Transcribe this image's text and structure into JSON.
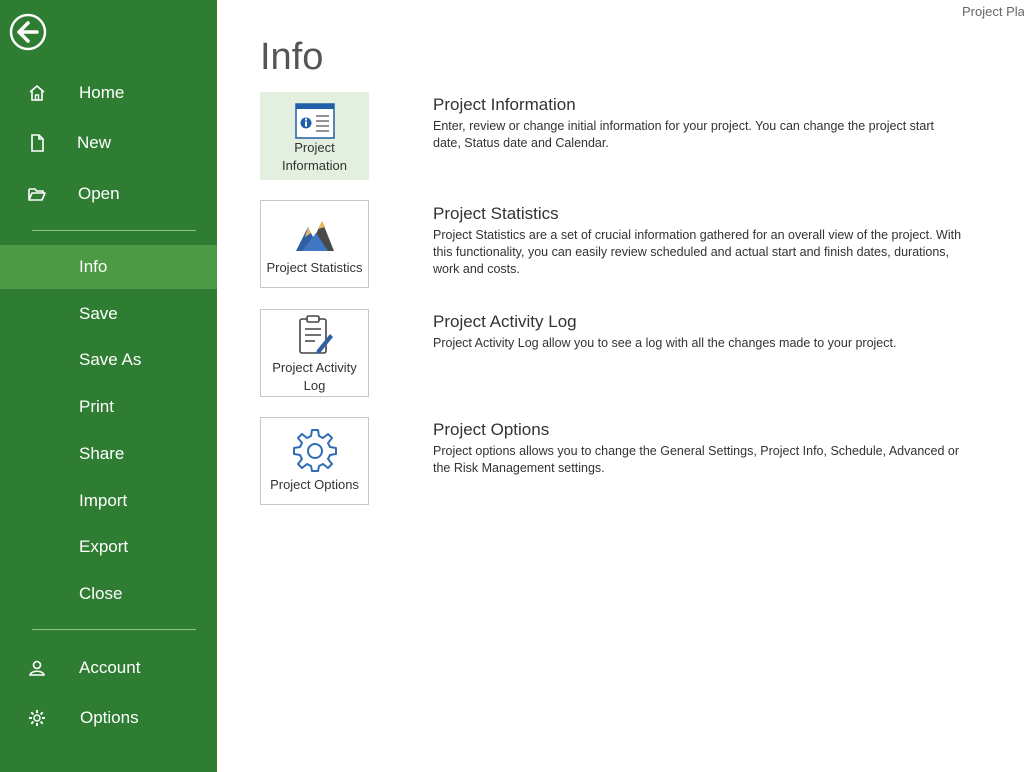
{
  "window": {
    "title": "Project Pla"
  },
  "page": {
    "title": "Info"
  },
  "sidebar": {
    "top_items": [
      {
        "label": "Home",
        "icon": "home-icon"
      },
      {
        "label": "New",
        "icon": "new-file-icon"
      },
      {
        "label": "Open",
        "icon": "folder-open-icon"
      }
    ],
    "middle_items": [
      {
        "label": "Info"
      },
      {
        "label": "Save"
      },
      {
        "label": "Save As"
      },
      {
        "label": "Print"
      },
      {
        "label": "Share"
      },
      {
        "label": "Import"
      },
      {
        "label": "Export"
      },
      {
        "label": "Close"
      }
    ],
    "bottom_items": [
      {
        "label": "Account",
        "icon": "account-icon"
      },
      {
        "label": "Options",
        "icon": "gear-icon"
      }
    ],
    "active": "Info"
  },
  "tiles": [
    {
      "label": "Project Information",
      "icon": "project-information-icon",
      "heading": "Project Information",
      "description": "Enter, review or change initial information for your project. You can change the project start date, Status date and Calendar."
    },
    {
      "label": "Project Statistics",
      "icon": "project-statistics-icon",
      "heading": "Project Statistics",
      "description": "Project Statistics are a set of crucial information gathered for an overall view of the project. With this functionality, you can easily review scheduled and actual start and finish dates, durations, work and costs."
    },
    {
      "label": "Project Activity Log",
      "icon": "clipboard-pencil-icon",
      "heading": "Project Activity Log",
      "description": "Project Activity Log allow you to see a log with all the changes made to your project."
    },
    {
      "label": "Project Options",
      "icon": "gear-icon",
      "heading": "Project Options",
      "description": "Project options allows you to change the General Settings, Project Info, Schedule, Advanced or the Risk Management settings."
    }
  ],
  "colors": {
    "sidebar": "#2e7d32",
    "sidebar_active": "#4d9a44",
    "tile_selected": "#e3f0e0"
  }
}
